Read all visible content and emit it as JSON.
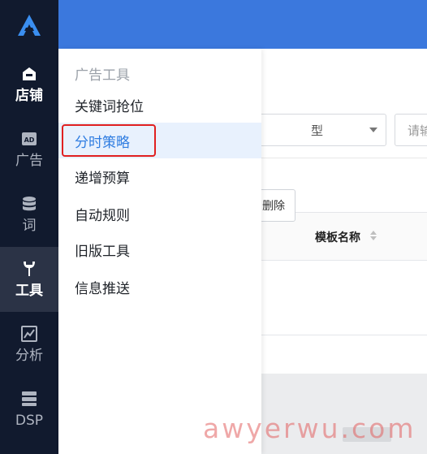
{
  "sidebar": {
    "items": [
      {
        "label": "店铺",
        "icon": "store-icon"
      },
      {
        "label": "广告",
        "icon": "ad-icon"
      },
      {
        "label": "词",
        "icon": "database-icon"
      },
      {
        "label": "工具",
        "icon": "wrench-icon"
      },
      {
        "label": "分析",
        "icon": "chart-icon"
      },
      {
        "label": "DSP",
        "icon": "server-icon"
      }
    ],
    "active": "工具"
  },
  "flyout": {
    "title": "广告工具",
    "items": [
      {
        "label": "关键词抢位"
      },
      {
        "label": "分时策略"
      },
      {
        "label": "递增预算"
      },
      {
        "label": "自动规则"
      },
      {
        "label": "旧版工具"
      },
      {
        "label": "信息推送"
      }
    ],
    "active": "分时策略"
  },
  "background": {
    "select_value_tail": "型",
    "input_placeholder": "请输",
    "column_header": "模板名称",
    "delete_label": "删除"
  },
  "watermark": "awyerwu.com",
  "colors": {
    "sidebar_bg": "#111a2e",
    "topbar": "#3b78dd",
    "active_text": "#2f7de1",
    "active_bg": "#e8f1fd",
    "highlight_box": "#e02020",
    "logo_blue": "#3a8ef0"
  }
}
